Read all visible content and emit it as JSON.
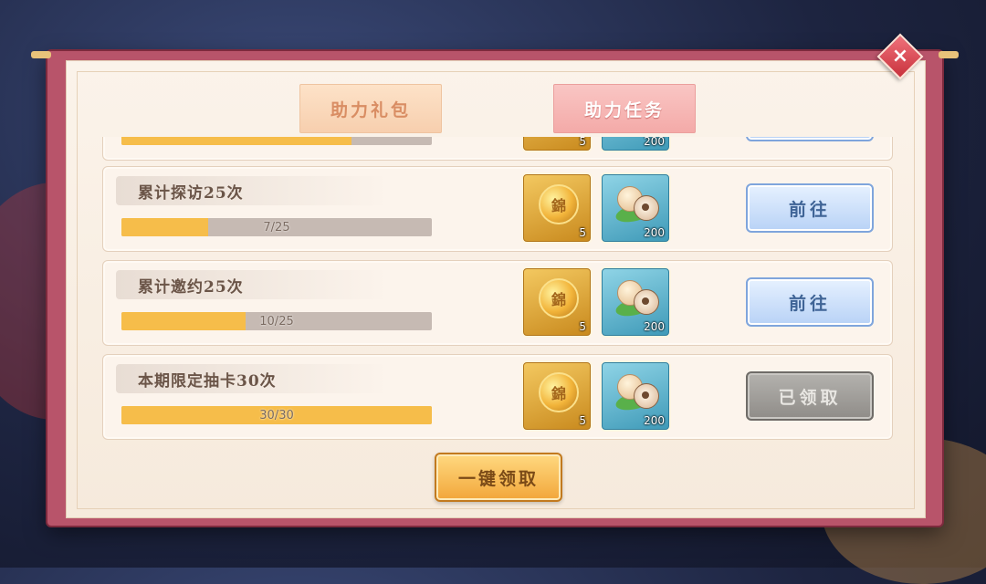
{
  "tabs": [
    {
      "label": "助力礼包",
      "active": false
    },
    {
      "label": "助力任务",
      "active": true
    }
  ],
  "tasks": [
    {
      "title": "",
      "progress_text": "",
      "progress_fraction": 0.74,
      "rewards": [
        {
          "icon": "gold-coin-icon",
          "count": "5"
        },
        {
          "icon": "food-bun-icon",
          "count": "200"
        }
      ],
      "action": ""
    },
    {
      "title": "累计探访25次",
      "progress_text": "7/25",
      "progress_fraction": 0.28,
      "rewards": [
        {
          "icon": "gold-coin-icon",
          "count": "5"
        },
        {
          "icon": "food-bun-icon",
          "count": "200"
        }
      ],
      "action": "前往"
    },
    {
      "title": "累计邀约25次",
      "progress_text": "10/25",
      "progress_fraction": 0.4,
      "rewards": [
        {
          "icon": "gold-coin-icon",
          "count": "5"
        },
        {
          "icon": "food-bun-icon",
          "count": "200"
        }
      ],
      "action": "前往"
    },
    {
      "title": "本期限定抽卡30次",
      "progress_text": "30/30",
      "progress_fraction": 1.0,
      "rewards": [
        {
          "icon": "gold-coin-icon",
          "count": "5"
        },
        {
          "icon": "food-bun-icon",
          "count": "200"
        }
      ],
      "action": "已领取"
    }
  ],
  "claim_all_label": "一键领取",
  "close_icon": "close-icon",
  "colors": {
    "progress": "#f6bd4a",
    "frame": "#b8546a",
    "go_button": "#b8d2f6",
    "claimed_button": "#8f8c88"
  }
}
